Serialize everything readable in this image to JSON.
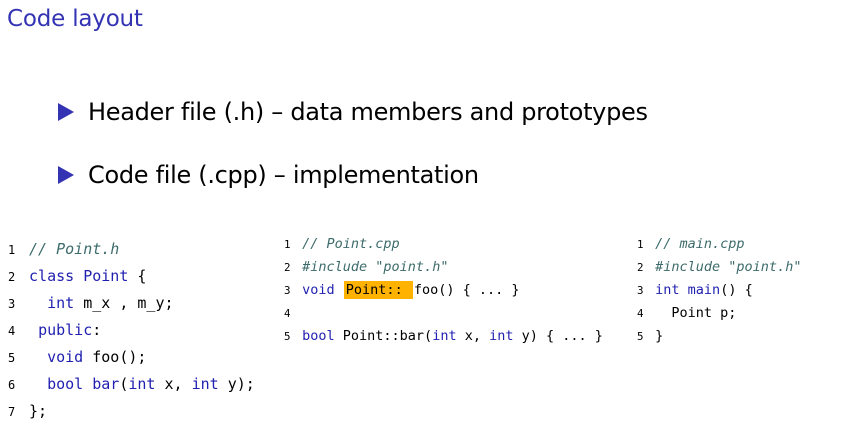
{
  "slide": {
    "title": "Code layout",
    "bullets": [
      "Header file (.h) – data members and prototypes",
      "Code file (.cpp) – implementation"
    ]
  },
  "code_header": {
    "lines": [
      {
        "num": "1",
        "parts": [
          {
            "t": "// Point.h",
            "c": "cm"
          }
        ]
      },
      {
        "num": "2",
        "parts": [
          {
            "t": "class ",
            "c": "kw"
          },
          {
            "t": "Point",
            "c": "kw"
          },
          {
            "t": " {",
            "c": ""
          }
        ]
      },
      {
        "num": "3",
        "parts": [
          {
            "t": "  ",
            "c": ""
          },
          {
            "t": "int",
            "c": "kw"
          },
          {
            "t": " m_x , m_y;",
            "c": ""
          }
        ]
      },
      {
        "num": "4",
        "parts": [
          {
            "t": " ",
            "c": ""
          },
          {
            "t": "public",
            "c": "kw"
          },
          {
            "t": ":",
            "c": ""
          }
        ]
      },
      {
        "num": "5",
        "parts": [
          {
            "t": "  ",
            "c": ""
          },
          {
            "t": "void",
            "c": "kw"
          },
          {
            "t": " foo();",
            "c": ""
          }
        ]
      },
      {
        "num": "6",
        "parts": [
          {
            "t": "  ",
            "c": ""
          },
          {
            "t": "bool",
            "c": "kw"
          },
          {
            "t": " ",
            "c": ""
          },
          {
            "t": "bar",
            "c": "kw"
          },
          {
            "t": "(",
            "c": ""
          },
          {
            "t": "int",
            "c": "kw"
          },
          {
            "t": " x, ",
            "c": ""
          },
          {
            "t": "int",
            "c": "kw"
          },
          {
            "t": " y);",
            "c": ""
          }
        ]
      },
      {
        "num": "7",
        "parts": [
          {
            "t": "};",
            "c": ""
          }
        ]
      }
    ]
  },
  "code_cpp": {
    "lines": [
      {
        "num": "1",
        "parts": [
          {
            "t": "// Point.cpp",
            "c": "cm"
          }
        ]
      },
      {
        "num": "2",
        "parts": [
          {
            "t": "#include ",
            "c": "pp"
          },
          {
            "t": "\"point.h\"",
            "c": "st"
          }
        ]
      },
      {
        "num": "3",
        "parts": [
          {
            "t": "void",
            "c": "kw"
          },
          {
            "t": " ",
            "c": ""
          },
          {
            "t": "Point:: ",
            "c": "hl"
          },
          {
            "t": "foo() { ... }",
            "c": ""
          }
        ]
      },
      {
        "num": "4",
        "parts": []
      },
      {
        "num": "5",
        "parts": [
          {
            "t": "bool",
            "c": "kw"
          },
          {
            "t": " Point::bar(",
            "c": ""
          },
          {
            "t": "int",
            "c": "kw"
          },
          {
            "t": " x, ",
            "c": ""
          },
          {
            "t": "int",
            "c": "kw"
          },
          {
            "t": " y) { ... }",
            "c": ""
          }
        ]
      }
    ]
  },
  "code_main": {
    "lines": [
      {
        "num": "1",
        "parts": [
          {
            "t": "// main.cpp",
            "c": "cm"
          }
        ]
      },
      {
        "num": "2",
        "parts": [
          {
            "t": "#include ",
            "c": "pp"
          },
          {
            "t": "\"point.h\"",
            "c": "st"
          }
        ]
      },
      {
        "num": "3",
        "parts": [
          {
            "t": "int",
            "c": "kw"
          },
          {
            "t": " ",
            "c": ""
          },
          {
            "t": "main",
            "c": "kw"
          },
          {
            "t": "() {",
            "c": ""
          }
        ]
      },
      {
        "num": "4",
        "parts": [
          {
            "t": "  Point p;",
            "c": ""
          }
        ]
      },
      {
        "num": "5",
        "parts": [
          {
            "t": "}",
            "c": ""
          }
        ]
      }
    ]
  }
}
